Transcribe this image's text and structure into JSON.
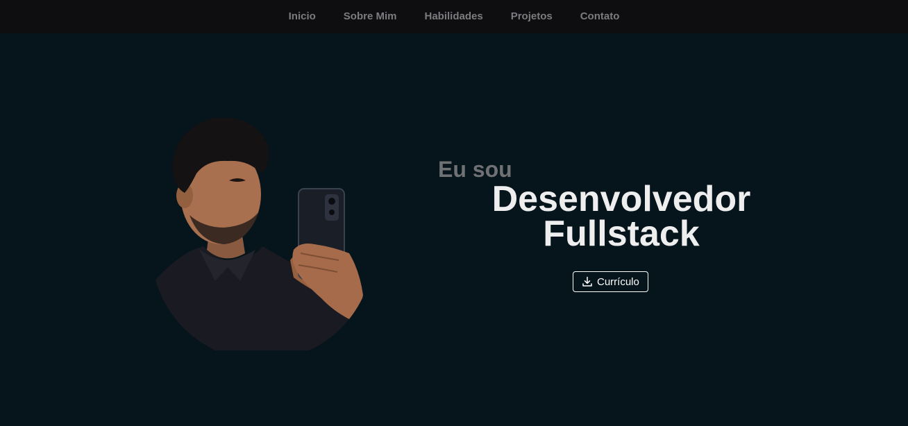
{
  "nav": {
    "items": [
      {
        "label": "Inicio"
      },
      {
        "label": "Sobre Mim"
      },
      {
        "label": "Habilidades"
      },
      {
        "label": "Projetos"
      },
      {
        "label": "Contato"
      }
    ]
  },
  "hero": {
    "intro": "Eu sou",
    "role_line1": "Desenvolvedor",
    "role_line2": "Fullstack",
    "cv_button_label": "Currículo",
    "cv_button_icon": "download-icon"
  },
  "colors": {
    "background": "#06141b",
    "navbar": "#0e0e10",
    "nav_text": "#7c7c80",
    "intro_text": "#6f7174",
    "title_text": "#eeeeef"
  }
}
